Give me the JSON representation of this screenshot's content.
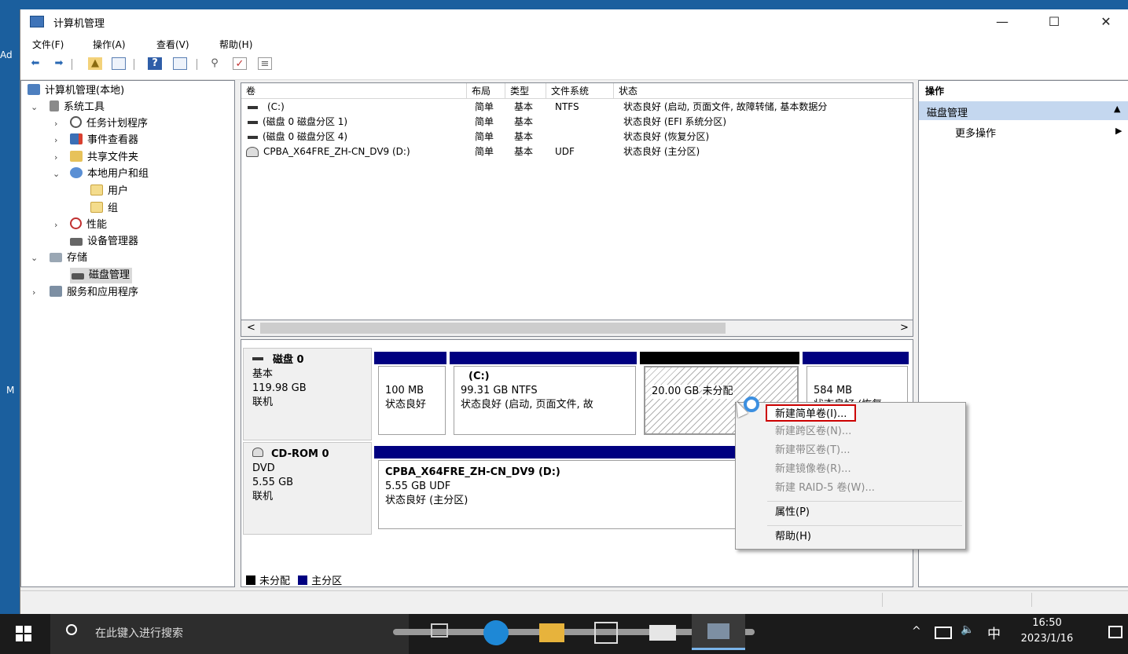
{
  "desktop": {
    "left_edge_text": "Ad",
    "left_edge_text2": "M"
  },
  "window": {
    "title": "计算机管理",
    "controls": {
      "minimize": "—",
      "maximize": "☐",
      "close": "✕"
    }
  },
  "menu": [
    "文件(F)",
    "操作(A)",
    "查看(V)",
    "帮助(H)"
  ],
  "tree": {
    "root": "计算机管理(本地)",
    "system_tools": "系统工具",
    "task_scheduler": "任务计划程序",
    "event_viewer": "事件查看器",
    "shared_folders": "共享文件夹",
    "local_users": "本地用户和组",
    "users": "用户",
    "groups": "组",
    "performance": "性能",
    "device_manager": "设备管理器",
    "storage": "存储",
    "disk_management": "磁盘管理",
    "services_apps": "服务和应用程序"
  },
  "volume_list": {
    "headers": [
      "卷",
      "布局",
      "类型",
      "文件系统",
      "状态"
    ],
    "rows": [
      {
        "name": "(C:)",
        "layout": "简单",
        "type": "基本",
        "fs": "NTFS",
        "status": "状态良好 (启动, 页面文件, 故障转储, 基本数据分"
      },
      {
        "name": "(磁盘 0 磁盘分区 1)",
        "layout": "简单",
        "type": "基本",
        "fs": "",
        "status": "状态良好 (EFI 系统分区)"
      },
      {
        "name": "(磁盘 0 磁盘分区 4)",
        "layout": "简单",
        "type": "基本",
        "fs": "",
        "status": "状态良好 (恢复分区)"
      },
      {
        "name": "CPBA_X64FRE_ZH-CN_DV9 (D:)",
        "layout": "简单",
        "type": "基本",
        "fs": "UDF",
        "status": "状态良好 (主分区)"
      }
    ],
    "scroll_left": "<",
    "scroll_right": ">"
  },
  "disks": [
    {
      "name": "磁盘 0",
      "type": "基本",
      "size": "119.98 GB",
      "state": "联机",
      "partitions": [
        {
          "title": "",
          "line1": "100 MB",
          "line2": "状态良好"
        },
        {
          "title": "(C:)",
          "line1": "99.31 GB NTFS",
          "line2": "状态良好 (启动, 页面文件, 故"
        },
        {
          "title": "",
          "line1": "20.00 GB",
          "line2": "未分配"
        },
        {
          "title": "",
          "line1": "584 MB",
          "line2": "状态良好 (恢复"
        }
      ]
    },
    {
      "name": "CD-ROM 0",
      "type": "DVD",
      "size": "5.55 GB",
      "state": "联机",
      "partitions": [
        {
          "title": "CPBA_X64FRE_ZH-CN_DV9  (D:)",
          "line1": "5.55 GB UDF",
          "line2": "状态良好 (主分区)"
        }
      ]
    }
  ],
  "legend": {
    "unallocated": "未分配",
    "primary": "主分区"
  },
  "actions": {
    "header": "操作",
    "section": "磁盘管理",
    "more": "更多操作"
  },
  "context_menu": {
    "items": [
      {
        "label": "新建简单卷(I)...",
        "enabled": true
      },
      {
        "label": "新建跨区卷(N)...",
        "enabled": false
      },
      {
        "label": "新建带区卷(T)...",
        "enabled": false
      },
      {
        "label": "新建镜像卷(R)...",
        "enabled": false
      },
      {
        "label": "新建 RAID-5 卷(W)...",
        "enabled": false
      },
      {
        "label": "属性(P)",
        "enabled": true
      },
      {
        "label": "帮助(H)",
        "enabled": true
      }
    ]
  },
  "taskbar": {
    "search_placeholder": "在此键入进行搜索",
    "tray": {
      "chevron": "^",
      "ime": "中",
      "time": "16:50",
      "date": "2023/1/16"
    }
  },
  "colors": {
    "primary_partition": "#000080",
    "unallocated": "#000000",
    "highlight_box": "#cc0000",
    "actions_section_bg": "#c4d7ef",
    "taskbar_bg": "#1b1b1b"
  }
}
